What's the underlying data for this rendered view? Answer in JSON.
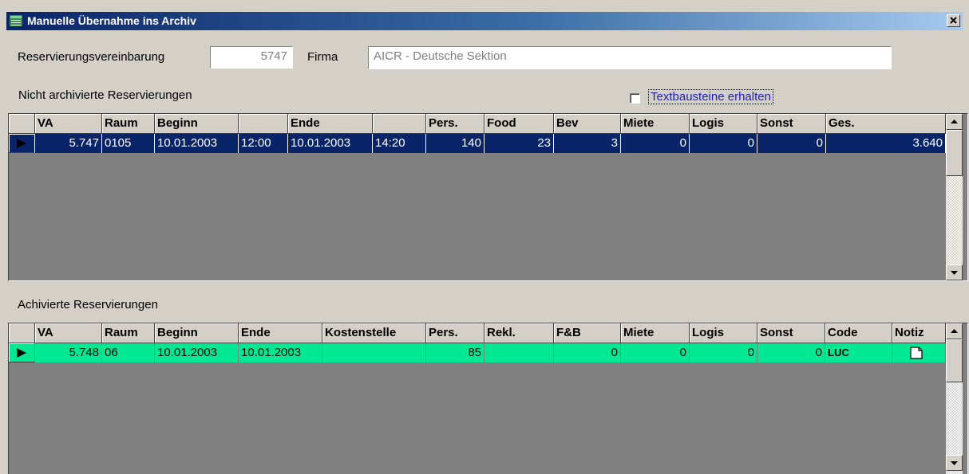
{
  "window": {
    "title": "Manuelle Übernahme ins Archiv"
  },
  "header": {
    "vereinbarung_label": "Reservierungsvereinbarung",
    "vereinbarung_value": "5747",
    "firma_label": "Firma",
    "firma_value": "AICR - Deutsche Sektion"
  },
  "top": {
    "section_label": "Nicht archivierte Reservierungen",
    "checkbox_label": "Textbausteine erhalten",
    "columns": [
      "VA",
      "Raum",
      "Beginn",
      "",
      "Ende",
      "",
      "Pers.",
      "Food",
      "Bev",
      "Miete",
      "Logis",
      "Sonst",
      "Ges."
    ],
    "rows": [
      [
        "5.747",
        "0105",
        "10.01.2003",
        "12:00",
        "10.01.2003",
        "14:20",
        "140",
        "23",
        "3",
        "0",
        "0",
        "0",
        "3.640"
      ]
    ]
  },
  "bottom": {
    "section_label": "Achivierte Reservierungen",
    "columns": [
      "VA",
      "Raum",
      "Beginn",
      "Ende",
      "Kostenstelle",
      "Pers.",
      "Rekl.",
      "F&B",
      "Miete",
      "Logis",
      "Sonst",
      "Code",
      "Notiz"
    ],
    "rows": [
      [
        "5.748",
        "06",
        "10.01.2003",
        "10.01.2003",
        "",
        "85",
        "",
        "0",
        "0",
        "0",
        "0",
        "LUC",
        ""
      ]
    ]
  },
  "icons": {
    "row_indicator": "triangle-right-icon",
    "note": "document-icon",
    "close": "close-icon",
    "app": "window-icon",
    "scroll_up": "arrow-up-icon",
    "scroll_down": "arrow-down-icon"
  },
  "colors": {
    "title_bar": "#0a246a",
    "selected_row": "#0a246a",
    "archived_row": "#00e893",
    "checkbox_label": "#1c1cc8"
  }
}
